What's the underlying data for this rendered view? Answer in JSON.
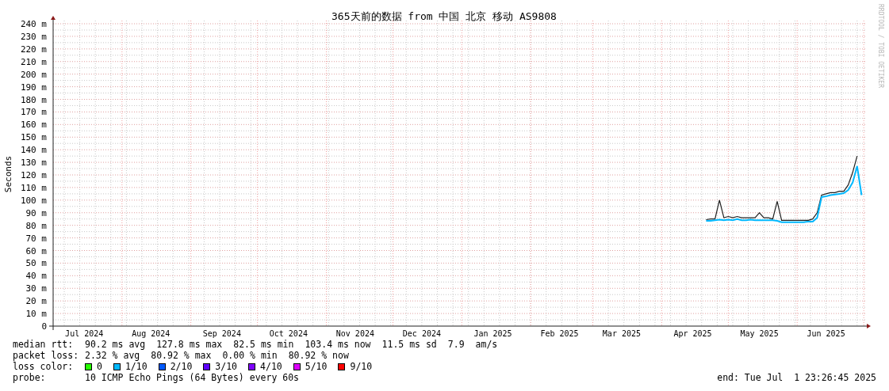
{
  "credit": "RRDTOOL / TOBI OETIKER",
  "chart": {
    "chart_data": {
      "type": "line",
      "title": "365天前的数据 from 中国 北京 移动 AS9808",
      "ylabel": "Seconds",
      "categories": [
        null,
        null,
        null,
        null,
        null,
        null,
        null,
        "Jul 2024",
        null,
        null,
        null,
        null,
        null,
        null,
        null,
        null,
        null,
        null,
        null,
        null,
        null,
        null,
        "Aug 2024",
        null,
        null,
        null,
        null,
        null,
        null,
        null,
        null,
        null,
        null,
        null,
        null,
        null,
        null,
        null,
        "Sep 2024",
        null,
        null,
        null,
        null,
        null,
        null,
        null,
        null,
        null,
        null,
        null,
        null,
        null,
        null,
        "Oct 2024",
        null,
        null,
        null,
        null,
        null,
        null,
        null,
        null,
        null,
        null,
        null,
        null,
        null,
        null,
        "Nov 2024",
        null,
        null,
        null,
        null,
        null,
        null,
        null,
        null,
        null,
        null,
        null,
        null,
        null,
        null,
        "Dec 2024",
        null,
        null,
        null,
        null,
        null,
        null,
        null,
        null,
        null,
        null,
        null,
        null,
        null,
        null,
        null,
        "Jan 2025",
        null,
        null,
        null,
        null,
        null,
        null,
        null,
        null,
        null,
        null,
        null,
        null,
        null,
        null,
        "Feb 2025",
        null,
        null,
        null,
        null,
        null,
        null,
        null,
        null,
        null,
        null,
        null,
        null,
        null,
        "Mar 2025",
        null,
        null,
        null,
        null,
        null,
        null,
        null,
        null,
        null,
        null,
        null,
        null,
        null,
        null,
        null,
        "Apr 2025",
        null,
        null,
        null,
        null,
        null,
        null,
        null,
        null,
        null,
        null,
        null,
        null,
        null,
        null,
        "May 2025",
        null,
        null,
        null,
        null,
        null,
        null,
        null,
        null,
        null,
        null,
        null,
        null,
        null,
        null,
        "Jun 2025",
        null,
        null,
        null,
        null,
        null,
        null,
        null,
        null
      ],
      "series": [
        {
          "color": "#202020",
          "values": [
            null,
            null,
            null,
            null,
            null,
            null,
            null,
            null,
            null,
            null,
            null,
            null,
            null,
            null,
            null,
            null,
            null,
            null,
            null,
            null,
            null,
            null,
            null,
            null,
            null,
            null,
            null,
            null,
            null,
            null,
            null,
            null,
            null,
            null,
            null,
            null,
            null,
            null,
            null,
            null,
            null,
            null,
            null,
            null,
            null,
            null,
            null,
            null,
            null,
            null,
            null,
            null,
            null,
            null,
            null,
            null,
            null,
            null,
            null,
            null,
            null,
            null,
            null,
            null,
            null,
            null,
            null,
            null,
            null,
            null,
            null,
            null,
            null,
            null,
            null,
            null,
            null,
            null,
            null,
            null,
            null,
            null,
            null,
            null,
            null,
            null,
            null,
            null,
            null,
            null,
            null,
            null,
            null,
            null,
            null,
            null,
            null,
            null,
            null,
            null,
            null,
            null,
            null,
            null,
            null,
            null,
            null,
            null,
            null,
            null,
            null,
            null,
            null,
            null,
            null,
            null,
            null,
            null,
            null,
            null,
            null,
            null,
            null,
            null,
            null,
            null,
            null,
            null,
            null,
            null,
            null,
            null,
            null,
            null,
            null,
            null,
            null,
            null,
            null,
            null,
            null,
            null,
            null,
            null,
            null,
            null,
            null,
            84.5,
            85,
            85,
            100,
            86,
            87,
            86,
            87,
            86,
            86,
            86,
            86,
            90,
            86,
            86,
            85,
            99,
            84,
            84,
            84,
            84,
            84,
            84,
            84,
            85,
            90,
            104,
            105,
            106,
            106,
            107,
            107,
            112,
            122,
            135,
            null
          ]
        },
        {
          "color": "#00b8ff",
          "values": [
            null,
            null,
            null,
            null,
            null,
            null,
            null,
            null,
            null,
            null,
            null,
            null,
            null,
            null,
            null,
            null,
            null,
            null,
            null,
            null,
            null,
            null,
            null,
            null,
            null,
            null,
            null,
            null,
            null,
            null,
            null,
            null,
            null,
            null,
            null,
            null,
            null,
            null,
            null,
            null,
            null,
            null,
            null,
            null,
            null,
            null,
            null,
            null,
            null,
            null,
            null,
            null,
            null,
            null,
            null,
            null,
            null,
            null,
            null,
            null,
            null,
            null,
            null,
            null,
            null,
            null,
            null,
            null,
            null,
            null,
            null,
            null,
            null,
            null,
            null,
            null,
            null,
            null,
            null,
            null,
            null,
            null,
            null,
            null,
            null,
            null,
            null,
            null,
            null,
            null,
            null,
            null,
            null,
            null,
            null,
            null,
            null,
            null,
            null,
            null,
            null,
            null,
            null,
            null,
            null,
            null,
            null,
            null,
            null,
            null,
            null,
            null,
            null,
            null,
            null,
            null,
            null,
            null,
            null,
            null,
            null,
            null,
            null,
            null,
            null,
            null,
            null,
            null,
            null,
            null,
            null,
            null,
            null,
            null,
            null,
            null,
            null,
            null,
            null,
            null,
            null,
            null,
            null,
            null,
            null,
            null,
            null,
            83.5,
            83.5,
            84,
            84.5,
            84,
            84.5,
            84,
            85,
            84,
            84,
            84.5,
            84,
            84,
            84,
            84,
            84,
            83.5,
            82.5,
            82.5,
            82.5,
            82.5,
            82.5,
            82.5,
            83,
            83,
            86,
            102.5,
            103,
            104,
            104.5,
            105,
            105.5,
            108,
            114,
            127,
            104
          ]
        }
      ],
      "ylim": [
        0,
        240
      ],
      "grid": true,
      "yticks": [
        {
          "value": 0,
          "label": "0"
        },
        {
          "value": 10,
          "label": "10 m"
        },
        {
          "value": 20,
          "label": "20 m"
        },
        {
          "value": 30,
          "label": "30 m"
        },
        {
          "value": 40,
          "label": "40 m"
        },
        {
          "value": 50,
          "label": "50 m"
        },
        {
          "value": 60,
          "label": "60 m"
        },
        {
          "value": 70,
          "label": "70 m"
        },
        {
          "value": 80,
          "label": "80 m"
        },
        {
          "value": 90,
          "label": "90 m"
        },
        {
          "value": 100,
          "label": "100 m"
        },
        {
          "value": 110,
          "label": "110 m"
        },
        {
          "value": 120,
          "label": "120 m"
        },
        {
          "value": 130,
          "label": "130 m"
        },
        {
          "value": 140,
          "label": "140 m"
        },
        {
          "value": 150,
          "label": "150 m"
        },
        {
          "value": 160,
          "label": "160 m"
        },
        {
          "value": 170,
          "label": "170 m"
        },
        {
          "value": 180,
          "label": "180 m"
        },
        {
          "value": 190,
          "label": "190 m"
        },
        {
          "value": 200,
          "label": "200 m"
        },
        {
          "value": 210,
          "label": "210 m"
        },
        {
          "value": 220,
          "label": "220 m"
        },
        {
          "value": 230,
          "label": "230 m"
        },
        {
          "value": 240,
          "label": "240 m"
        }
      ]
    }
  },
  "legend": {
    "rows": [
      {
        "kind": "stats",
        "label": "median rtt:",
        "items": [
          "90.2 ms avg",
          "127.8 ms max",
          "82.5 ms min",
          "103.4 ms now",
          "11.5 ms sd",
          "7.9",
          "am/s"
        ]
      },
      {
        "kind": "stats",
        "label": "packet loss:",
        "items": [
          "2.32 % avg",
          "80.92 % max",
          "0.00 % min",
          "80.92 % now"
        ]
      },
      {
        "kind": "colors",
        "label": "loss color:",
        "items": [
          {
            "label": "0",
            "color": "#26ff00"
          },
          {
            "label": "1/10",
            "color": "#00b8ff"
          },
          {
            "label": "2/10",
            "color": "#0059ff"
          },
          {
            "label": "3/10",
            "color": "#5e00ff"
          },
          {
            "label": "4/10",
            "color": "#7e00ff"
          },
          {
            "label": "5/10",
            "color": "#dd00ff"
          },
          {
            "label": "9/10",
            "color": "#ff0000"
          }
        ]
      },
      {
        "kind": "probe",
        "label": "probe:",
        "value": "10 ICMP Echo Pings (64 Bytes) every 60s",
        "end": "end: Tue Jul  1 23:26:45 2025"
      }
    ]
  }
}
